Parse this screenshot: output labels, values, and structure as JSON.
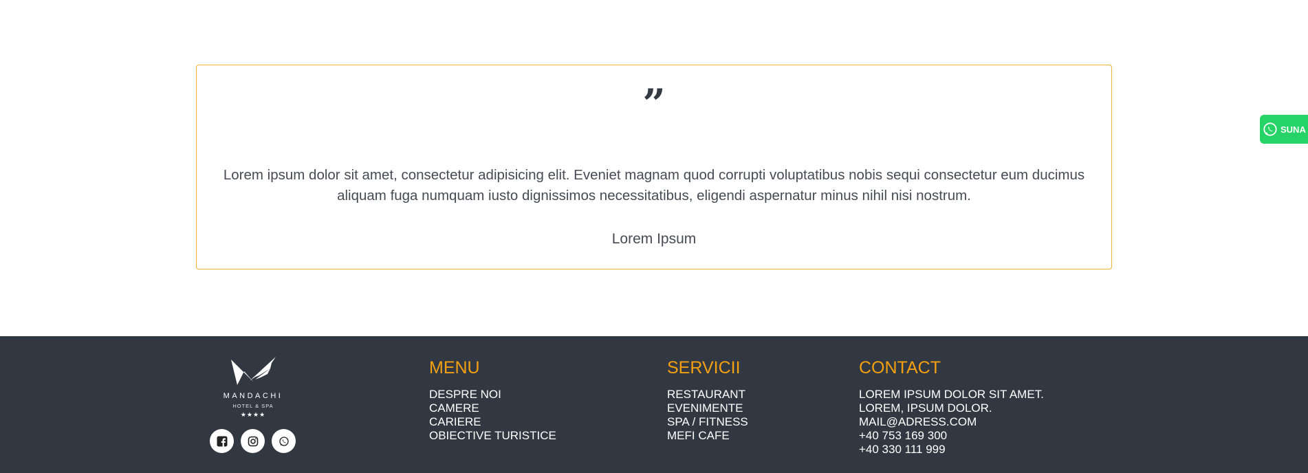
{
  "testimonial": {
    "quote_mark": "”",
    "text": "Lorem ipsum dolor sit amet, consectetur adipisicing elit. Eveniet magnam quod corrupti voluptatibus nobis sequi consectetur eum ducimus aliquam fuga numquam iusto dignissimos necessitatibus, eligendi aspernatur minus nihil nisi nostrum.",
    "author": "Lorem Ipsum"
  },
  "call_button": {
    "label": "SUNA",
    "icon": "whatsapp-icon"
  },
  "footer": {
    "logo": {
      "brand": "MANDACHI",
      "subtitle": "HOTEL & SPA",
      "stars": "★★★★"
    },
    "social": [
      {
        "icon": "facebook-icon"
      },
      {
        "icon": "instagram-icon"
      },
      {
        "icon": "whatsapp-icon"
      }
    ],
    "menu": {
      "title": "MENU",
      "items": [
        "DESPRE NOI",
        "CAMERE",
        "CARIERE",
        "OBIECTIVE TURISTICE"
      ]
    },
    "services": {
      "title": "SERVICII",
      "items": [
        "RESTAURANT",
        "EVENIMENTE",
        "SPA / FITNESS",
        "MEFI CAFE"
      ]
    },
    "contact": {
      "title": "CONTACT",
      "items": [
        "LOREM IPSUM DOLOR SIT AMET.",
        "LOREM, IPSUM DOLOR.",
        "MAIL@ADRESS.COM",
        "+40 753 169 300",
        "+40 330 111 999"
      ]
    }
  },
  "colors": {
    "accent": "#f5a011",
    "card_border": "#f2b233",
    "footer_bg": "#313841",
    "whatsapp": "#25d366"
  }
}
